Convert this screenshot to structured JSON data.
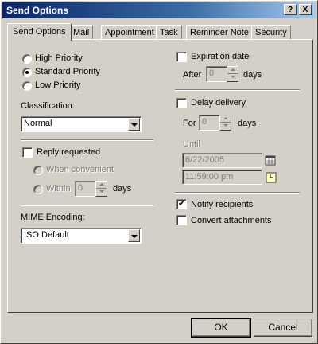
{
  "window": {
    "title": "Send Options",
    "help_button": "?",
    "close_button": "X"
  },
  "tabs": [
    {
      "label": "Send Options",
      "active": true
    },
    {
      "label": "Mail",
      "active": false
    },
    {
      "label": "Appointment",
      "active": false
    },
    {
      "label": "Task",
      "active": false
    },
    {
      "label": "Reminder Note",
      "active": false
    },
    {
      "label": "Security",
      "active": false
    }
  ],
  "priority": {
    "options": [
      "High Priority",
      "Standard Priority",
      "Low Priority"
    ],
    "selected": "Standard Priority"
  },
  "classification": {
    "label": "Classification:",
    "value": "Normal"
  },
  "reply": {
    "label": "Reply requested",
    "checked": false,
    "when_convenient": "When convenient",
    "within": "Within",
    "within_value": "0",
    "days": "days"
  },
  "mime": {
    "label": "MIME Encoding:",
    "value": "ISO Default"
  },
  "expiration": {
    "label": "Expiration date",
    "checked": false,
    "after": "After",
    "after_value": "0",
    "days": "days"
  },
  "delay": {
    "label": "Delay delivery",
    "checked": false,
    "for": "For",
    "for_value": "0",
    "days": "days",
    "until": "Until",
    "date": "6/22/2005",
    "time": "11:59:00 pm"
  },
  "notify": {
    "label": "Notify recipients",
    "checked": true
  },
  "convert": {
    "label": "Convert attachments",
    "checked": false
  },
  "buttons": {
    "ok": "OK",
    "cancel": "Cancel"
  },
  "icons": {
    "calendar": "calendar-icon",
    "clock": "clock-icon",
    "checkmark": "✔"
  }
}
